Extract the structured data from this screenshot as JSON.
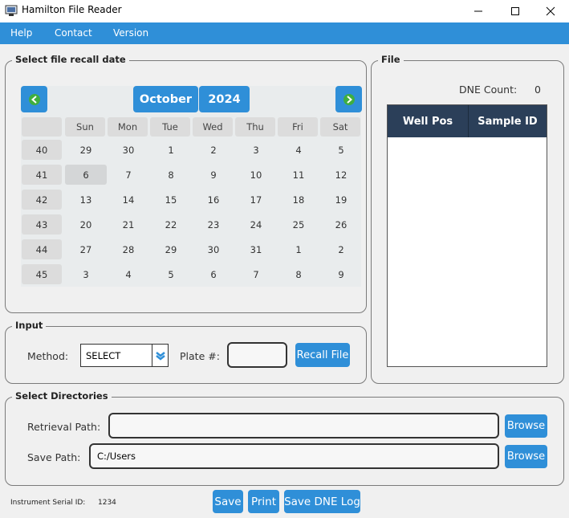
{
  "window": {
    "title": "Hamilton File Reader"
  },
  "menu": [
    "Help",
    "Contact",
    "Version"
  ],
  "recall": {
    "group_label": "Select file recall date",
    "month": "October",
    "year": "2024",
    "day_headers": [
      "Sun",
      "Mon",
      "Tue",
      "Wed",
      "Thu",
      "Fri",
      "Sat"
    ],
    "weeks": [
      {
        "week": "40",
        "days": [
          "29",
          "30",
          "1",
          "2",
          "3",
          "4",
          "5"
        ]
      },
      {
        "week": "41",
        "days": [
          "6",
          "7",
          "8",
          "9",
          "10",
          "11",
          "12"
        ]
      },
      {
        "week": "42",
        "days": [
          "13",
          "14",
          "15",
          "16",
          "17",
          "18",
          "19"
        ]
      },
      {
        "week": "43",
        "days": [
          "20",
          "21",
          "22",
          "23",
          "24",
          "25",
          "26"
        ]
      },
      {
        "week": "44",
        "days": [
          "27",
          "28",
          "29",
          "30",
          "31",
          "1",
          "2"
        ]
      },
      {
        "week": "45",
        "days": [
          "3",
          "4",
          "5",
          "6",
          "7",
          "8",
          "9"
        ]
      }
    ],
    "selected_day": "6"
  },
  "input": {
    "group_label": "Input",
    "method_label": "Method:",
    "method_value": "SELECT",
    "plate_label": "Plate #:",
    "plate_value": "",
    "recall_button": "Recall File"
  },
  "file": {
    "group_label": "File",
    "dne_label": "DNE Count:",
    "dne_value": "0",
    "columns": [
      "Well Pos",
      "Sample ID"
    ]
  },
  "directories": {
    "group_label": "Select Directories",
    "retrieval_label": "Retrieval Path:",
    "retrieval_value": "",
    "save_label": "Save Path:",
    "save_value": "C:/Users",
    "browse_label": "Browse"
  },
  "footer": {
    "serial_label": "Instrument Serial ID:",
    "serial_value": "1234",
    "save_button": "Save",
    "print_button": "Print",
    "save_dne_button": "Save DNE Log"
  },
  "colors": {
    "accent": "#2f8fd8",
    "table_header": "#2b3f59",
    "nav_arrow": "#3fae3f"
  }
}
